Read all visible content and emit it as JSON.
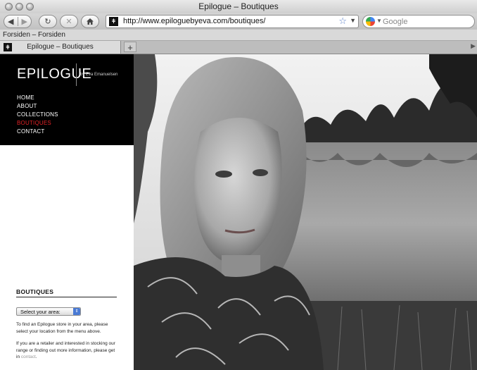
{
  "window": {
    "title": "Epilogue – Boutiques"
  },
  "toolbar": {
    "url": "http://www.epiloguebyeva.com/boutiques/",
    "search_placeholder": "Google"
  },
  "bookmarks": {
    "items": [
      "Forsiden – Forsiden"
    ]
  },
  "tabs": [
    {
      "label": "Epilogue – Boutiques",
      "active": true
    }
  ],
  "site": {
    "brand": "EPILOGUE",
    "brand_sub": "by Eva Emanuelsen",
    "nav": [
      {
        "label": "HOME",
        "active": false
      },
      {
        "label": "ABOUT",
        "active": false
      },
      {
        "label": "COLLECTIONS",
        "active": false
      },
      {
        "label": "BOUTIQUES",
        "active": true
      },
      {
        "label": "CONTACT",
        "active": false
      }
    ],
    "active_color": "#e32226"
  },
  "boutiques": {
    "heading": "BOUTIQUES",
    "select_value": "Select your area:",
    "paragraph1": "To find an Epilogue store in your area, please select your location from the menu above.",
    "paragraph2": "If you are a retailer and interested in stocking our range or finding out more information, please get in",
    "contact_link": "contact",
    "paragraph2_end": "."
  },
  "icons": {
    "back": "back-arrow-icon",
    "forward": "forward-arrow-icon",
    "reload": "reload-icon",
    "stop": "stop-icon",
    "home": "home-icon",
    "bookmark": "star-icon",
    "search_engine": "google-icon"
  }
}
